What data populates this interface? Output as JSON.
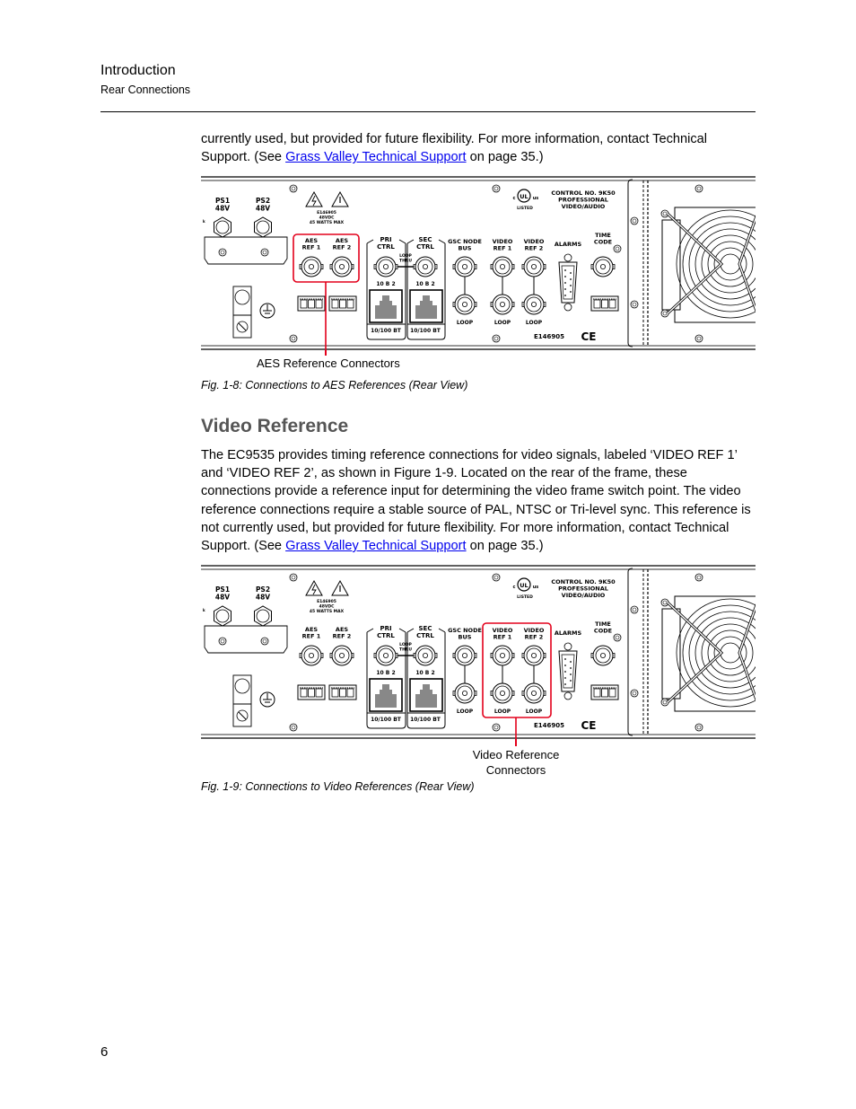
{
  "header": {
    "chapter": "Introduction",
    "section": "Rear Connections"
  },
  "intro_paragraph": {
    "text_before_link": "currently used, but provided for future flexibility. For more information, contact Technical Support. (See ",
    "link_text": "Grass Valley Technical Support",
    "text_after_link": " on page 35.)"
  },
  "panel_labels": {
    "ps1": "PS1",
    "ps2": "PS2",
    "voltage": "48V",
    "warning_code": "E146905",
    "warning_vdc": "48VDC",
    "warning_watts": "45 WATTS MAX",
    "aes_ref_1": [
      "AES",
      "REF 1"
    ],
    "aes_ref_2": [
      "AES",
      "REF 2"
    ],
    "pri_ctrl": [
      "PRI",
      "CTRL"
    ],
    "sec_ctrl": [
      "SEC",
      "CTRL"
    ],
    "loop_thru": [
      "LOOP",
      "THRU"
    ],
    "ten_b2": "10 B 2",
    "ethernet": "10/100 BT",
    "gsc_node_bus": [
      "GSC NODE",
      "BUS"
    ],
    "video_ref_1": [
      "VIDEO",
      "REF 1"
    ],
    "video_ref_2": [
      "VIDEO",
      "REF 2"
    ],
    "alarms": "ALARMS",
    "time_code": [
      "TIME",
      "CODE"
    ],
    "loop": "LOOP",
    "ul_listed": "LISTED",
    "ul_c": "c",
    "ul_us": "us",
    "ul_mark": "UL",
    "control_no": [
      "CONTROL NO. 9K50",
      "PROFESSIONAL",
      "VIDEO/AUDIO"
    ],
    "bottom_code": "E146905",
    "ce_mark": "CE"
  },
  "figure_1_8": {
    "highlight": "aes",
    "callout": "AES Reference Connectors",
    "caption": "Fig. 1-8: Connections to AES References (Rear View)"
  },
  "section": {
    "heading": "Video Reference",
    "paragraph_text": "The EC9535 provides timing reference connections for video signals, labeled ‘VIDEO REF 1’ and ‘VIDEO REF 2’, as shown in Figure 1-9. Located on the rear of the frame, these connections provide a reference input for determining the video frame switch point. The video reference connections require a stable source of PAL, NTSC or Tri-level sync. This reference is not currently used, but provided for future flexibility. For more information, contact Technical Support. (See ",
    "link_text": "Grass Valley Technical Support",
    "text_after_link": " on page 35.)"
  },
  "figure_1_9": {
    "highlight": "video",
    "callout_line1": "Video Reference",
    "callout_line2": "Connectors",
    "caption": "Fig. 1-9: Connections to Video References (Rear View)"
  },
  "colors": {
    "link": "#0000ee",
    "highlight": "#e3001b",
    "heading": "#555555"
  },
  "page_number": "6"
}
